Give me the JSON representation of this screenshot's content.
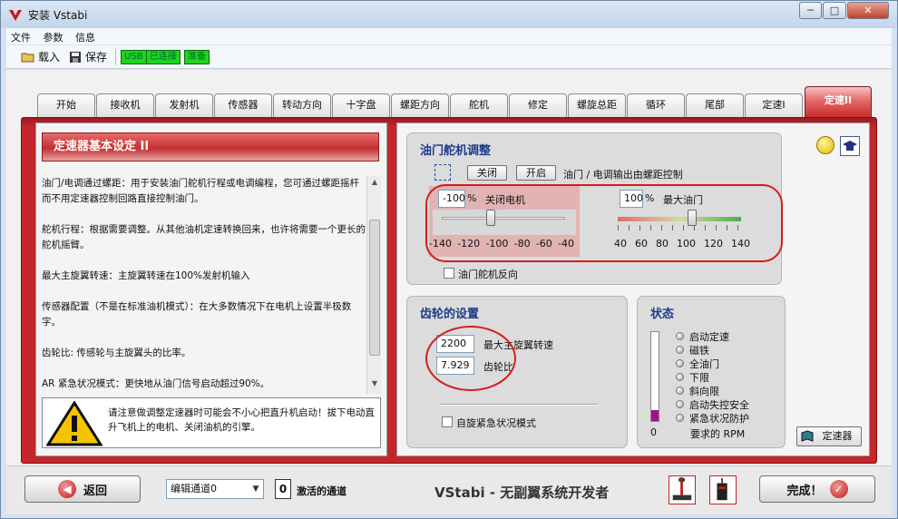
{
  "window": {
    "title": "安装 Vstabi",
    "buttons": [
      "─",
      "□",
      "✕"
    ]
  },
  "menu": [
    "文件",
    "参数",
    "信息"
  ],
  "toolbar": {
    "load": "载入",
    "save": "保存",
    "usb": "USB",
    "connected": "已连接",
    "ready": "准备"
  },
  "tabs": [
    "开始",
    "接收机",
    "发射机",
    "传感器",
    "转动方向",
    "十字盘",
    "螺距方向",
    "舵机",
    "修定",
    "螺旋总距",
    "循环",
    "尾部",
    "定速I",
    "定速II"
  ],
  "active_tab_index": 13,
  "left": {
    "header": "定速器基本设定 II",
    "paragraphs": [
      "油门/电调通过螺距：用于安装油门舵机行程或电调编程，您可通过螺距摇杆而不用定速器控制回路直接控制油门。",
      "舵机行程：根据需要调整。从其他油机定速转换回来，也许将需要一个更长的舵机摇臂。",
      "最大主旋翼转速：主旋翼转速在100%发射机输入",
      " 传感器配置（不是在标准油机模式）：在大多数情况下在电机上设置半极数字。",
      "齿轮比: 传感轮与主旋翼头的比率。",
      "AR 紧急状况模式：更快地从油门信号启动超过90%。"
    ],
    "warning": "请注意做调整定速器时可能会不小心把直升机启动！拔下电动直升飞机上的电机、关闭油机的引擎。"
  },
  "throttle": {
    "title": "油门舵机调整",
    "btn_close": "关闭",
    "btn_open": "开启",
    "desc": "油门 / 电调输出由螺距控制",
    "low_value": "-100",
    "low_unit": "%",
    "low_label": "关闭电机",
    "low_scale": [
      "-140",
      "-120",
      "-100",
      "-80",
      "-60",
      "-40"
    ],
    "low_slider_value": -100,
    "high_value": "100",
    "high_unit": "%",
    "high_label": "最大油门",
    "high_scale": [
      "40",
      "60",
      "80",
      "100",
      "120",
      "140"
    ],
    "high_slider_value": 100,
    "reverse_label": "油门舵机反向"
  },
  "gear": {
    "title": "齿轮的设置",
    "max_rpm_value": "2200",
    "max_rpm_label": "最大主旋翼转速",
    "ratio_value": "7.929",
    "ratio_label": "齿轮比",
    "autorot_label": "自旋紧急状况模式"
  },
  "status": {
    "title": "状态",
    "items": [
      "启动定速",
      "磁铁",
      "全油门",
      "下限",
      "斜向限",
      "启动失控安全",
      "紧急状况防护"
    ],
    "bar_value": "0",
    "rpm_label": "要求的 RPM",
    "bar_fraction": 0.12,
    "governor_btn": "定速器"
  },
  "bottom": {
    "back": "返回",
    "channel_select": "编辑通道0",
    "active_count": "0",
    "active_label": "激活的通道",
    "brand": "VStabi - 无副翼系统开发者",
    "finish": "完成！"
  }
}
